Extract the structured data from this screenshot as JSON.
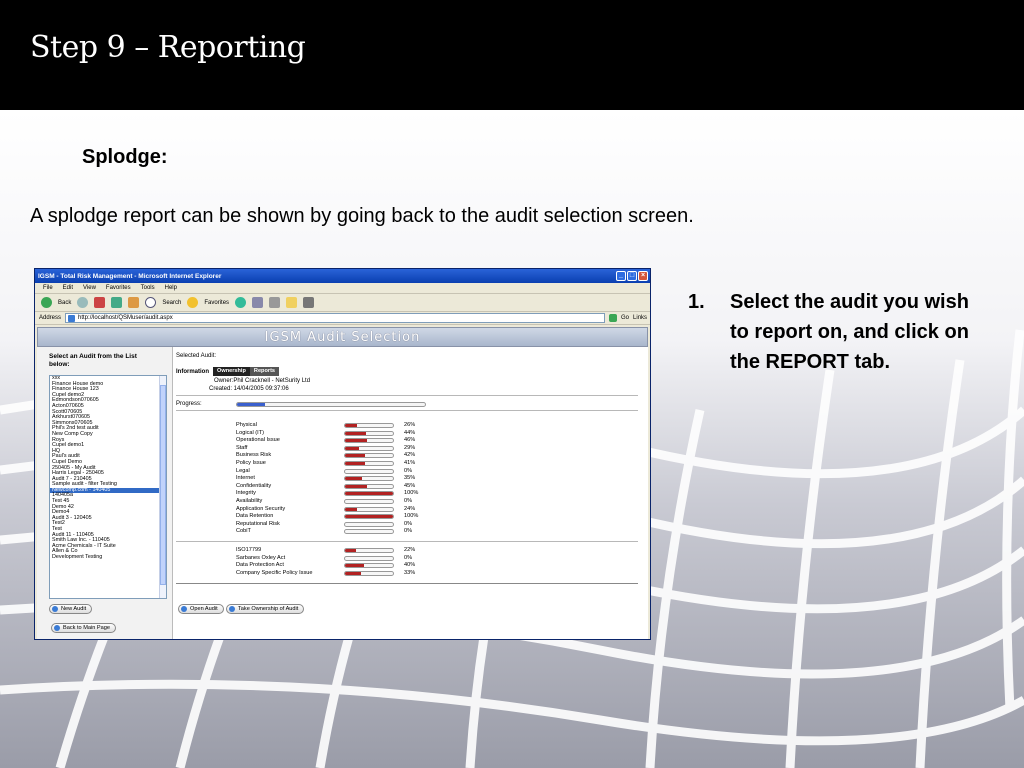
{
  "slide": {
    "title": "Step 9 – Reporting",
    "subtitle": "Splodge:",
    "description": "A splodge report can be shown by going back to the audit selection screen.",
    "steps": [
      {
        "number": "1.",
        "text": "Select the audit you wish to report on, and click on the REPORT tab."
      }
    ]
  },
  "browser": {
    "title": "IGSM - Total Risk Management - Microsoft Internet Explorer",
    "menu": [
      "File",
      "Edit",
      "View",
      "Favorites",
      "Tools",
      "Help"
    ],
    "toolbar": {
      "back": "Back",
      "search": "Search",
      "favorites": "Favorites"
    },
    "address_label": "Address",
    "address": "http://localhost/QSMuser/audit.aspx",
    "go": "Go",
    "links": "Links"
  },
  "app": {
    "header": "IGSM Audit Selection",
    "left_heading": "Select an Audit from the List below:",
    "audits": [
      "xxx",
      "Finance House demo",
      "Finance House 123",
      "Cupel demo2",
      "Edmondson070605",
      "Acton070605",
      "Scott070605",
      "Arkhurst070605",
      "Simmons070605",
      "Phil's 2nd test audit",
      "New Comp Copy",
      "Roys",
      "Cupel demo1",
      "HQ",
      "Paul's audit",
      "Cupel Demo",
      "250405 - My Audit",
      "Harris Legal - 250405",
      "Audit 7 - 210405",
      "Sample audit - filter Testing",
      "Newcomp.com - 140405",
      "140405a",
      "Test 45",
      "Demo 42",
      "Demo4",
      "Audit 3 - 120405",
      "Test2",
      "Test",
      "Audit 11 - 110405",
      "Smith Law Inc. - 110405",
      "Acme Chemicals - IT Suite",
      "Allen & Co",
      "Development Testing"
    ],
    "selected_audit_index": 20,
    "new_audit_button": "New Audit",
    "back_button": "Back to Main Page",
    "selected_audit_label": "Selected Audit:",
    "information_label": "Information",
    "tabs": [
      "Ownership",
      "Reports"
    ],
    "owner": "Owner:Phil Cracknell - NetSurity Ltd",
    "created": "Created: 14/04/2005 09:37:06",
    "progress_label": "Progress:",
    "progress_value": 0.15,
    "metrics": [
      {
        "label": "Physical",
        "pct": "26%",
        "value": 26
      },
      {
        "label": "Logical (IT)",
        "pct": "44%",
        "value": 44
      },
      {
        "label": "Operational Issue",
        "pct": "46%",
        "value": 46
      },
      {
        "label": "Staff",
        "pct": "29%",
        "value": 29
      },
      {
        "label": "Business Risk",
        "pct": "42%",
        "value": 42
      },
      {
        "label": "Policy Issue",
        "pct": "41%",
        "value": 41
      },
      {
        "label": "Legal",
        "pct": "0%",
        "value": 0
      },
      {
        "label": "Internet",
        "pct": "35%",
        "value": 35
      },
      {
        "label": "Confidentiality",
        "pct": "45%",
        "value": 45
      },
      {
        "label": "Integrity",
        "pct": "100%",
        "value": 100
      },
      {
        "label": "Availability",
        "pct": "0%",
        "value": 0
      },
      {
        "label": "Application Security",
        "pct": "24%",
        "value": 24
      },
      {
        "label": "Data Retention",
        "pct": "100%",
        "value": 100
      },
      {
        "label": "Reputational Risk",
        "pct": "0%",
        "value": 0
      },
      {
        "label": "CobiT",
        "pct": "0%",
        "value": 0
      }
    ],
    "standards": [
      {
        "label": "ISO17799",
        "pct": "22%",
        "value": 22
      },
      {
        "label": "Sarbanes Oxley Act",
        "pct": "0%",
        "value": 0
      },
      {
        "label": "Data Protection Act",
        "pct": "40%",
        "value": 40
      },
      {
        "label": "Company Specific Policy Issue",
        "pct": "33%",
        "value": 33
      }
    ],
    "open_audit_button": "Open Audit",
    "take_ownership_button": "Take Ownership of Audit"
  },
  "colors": {
    "bar_fill": "#b22222",
    "progress_fill": "#3a5fcd",
    "selection": "#316ac5"
  }
}
